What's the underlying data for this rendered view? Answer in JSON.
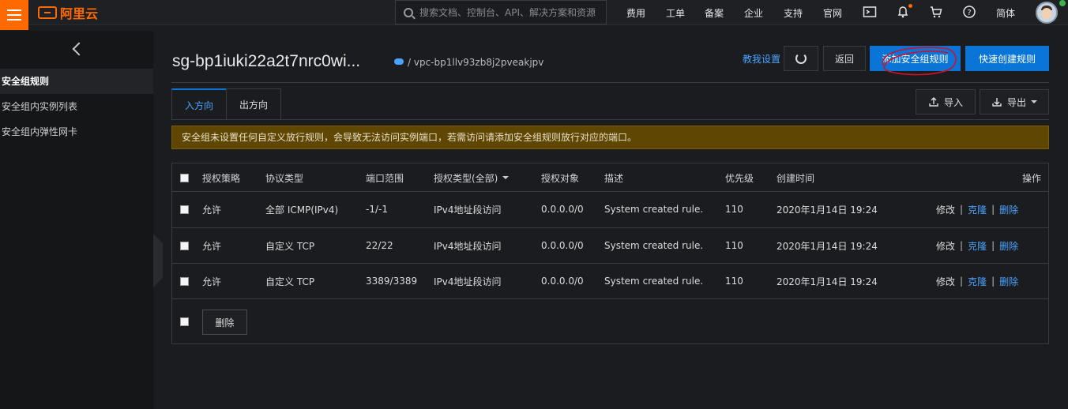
{
  "topbar": {
    "brand": "阿里云",
    "search_placeholder": "搜索文档、控制台、API、解决方案和资源",
    "nav": [
      "费用",
      "工单",
      "备案",
      "企业",
      "支持",
      "官网"
    ],
    "language": "简体",
    "icons": [
      "menu-icon",
      "search-icon",
      "terminal-icon",
      "bell-icon",
      "cart-icon",
      "help-icon",
      "avatar"
    ]
  },
  "sidebar": {
    "items": [
      {
        "label": "安全组规则",
        "active": true
      },
      {
        "label": "安全组内实例列表",
        "active": false
      },
      {
        "label": "安全组内弹性网卡",
        "active": false
      }
    ]
  },
  "header": {
    "title": "sg-bp1iuki22a2t7nrc0wi...",
    "vpc": "/ vpc-bp1llv93zb8j2pveakjpv",
    "help_link": "教我设置",
    "back": "返回",
    "add_rule": "添加安全组规则",
    "quick_create": "快速创建规则"
  },
  "tabs": [
    {
      "label": "入方向",
      "active": true
    },
    {
      "label": "出方向",
      "active": false
    }
  ],
  "actions": {
    "import": "导入",
    "export": "导出"
  },
  "notice": "安全组未设置任何自定义放行规则，会导致无法访问实例端口，若需访问请添加安全组规则放行对应的端口。",
  "table": {
    "columns": [
      "授权策略",
      "协议类型",
      "端口范围",
      "授权类型(全部)",
      "授权对象",
      "描述",
      "优先级",
      "创建时间",
      "操作"
    ],
    "rows": [
      {
        "policy": "允许",
        "protocol": "全部 ICMP(IPv4)",
        "ports": "-1/-1",
        "auth_type": "IPv4地址段访问",
        "target": "0.0.0.0/0",
        "desc": "System created rule.",
        "priority": "110",
        "created": "2020年1月14日 19:24"
      },
      {
        "policy": "允许",
        "protocol": "自定义 TCP",
        "ports": "22/22",
        "auth_type": "IPv4地址段访问",
        "target": "0.0.0.0/0",
        "desc": "System created rule.",
        "priority": "110",
        "created": "2020年1月14日 19:24"
      },
      {
        "policy": "允许",
        "protocol": "自定义 TCP",
        "ports": "3389/3389",
        "auth_type": "IPv4地址段访问",
        "target": "0.0.0.0/0",
        "desc": "System created rule.",
        "priority": "110",
        "created": "2020年1月14日 19:24"
      }
    ],
    "row_actions": {
      "edit": "修改",
      "clone": "克隆",
      "delete": "删除"
    },
    "bulk_delete": "删除"
  },
  "colors": {
    "accent": "#0a75d6",
    "brand": "#ff6a00",
    "notice_bg": "#5f4703",
    "annotation": "#d0102a"
  }
}
